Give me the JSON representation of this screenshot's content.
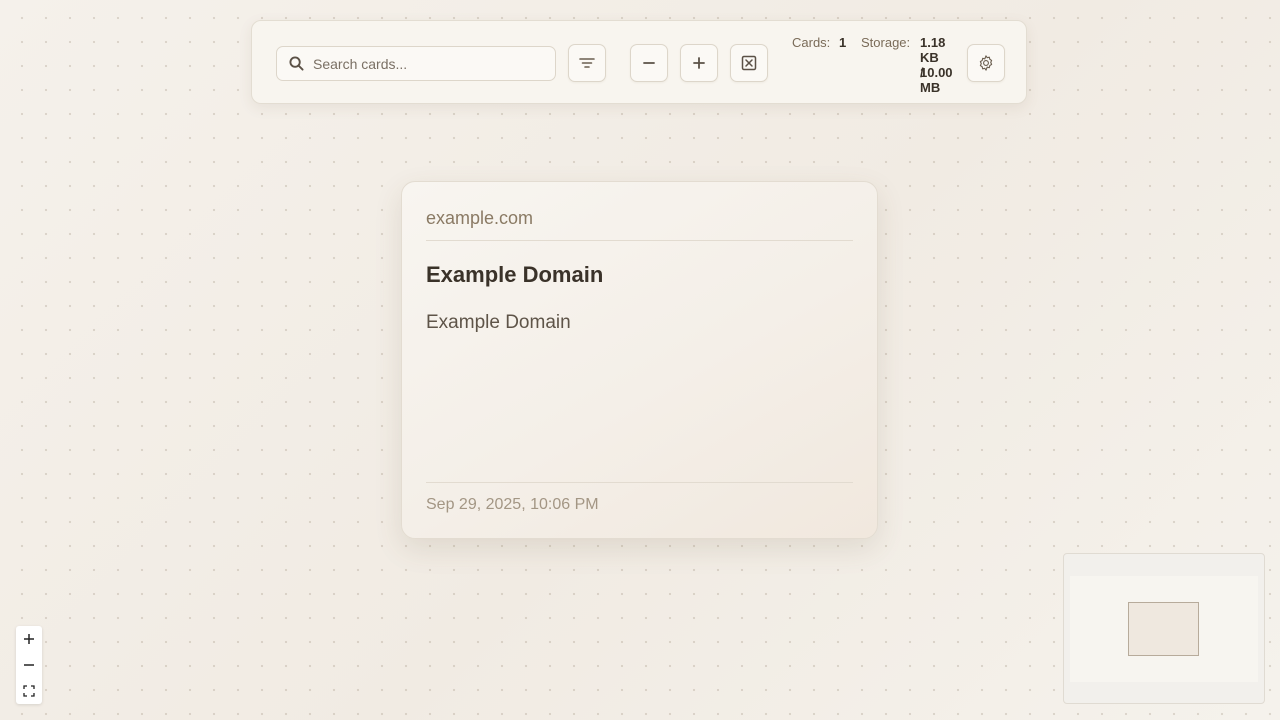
{
  "toolbar": {
    "search_placeholder": "Search cards...",
    "buttons": {
      "filter": "filter-icon",
      "zoom_out": "minus-icon",
      "zoom_in": "plus-icon",
      "fit": "close-box-icon",
      "settings": "gear-icon"
    },
    "stats": {
      "cards_label": "Cards:",
      "cards_value": "1",
      "storage_label": "Storage:",
      "storage_line1": "1.18",
      "storage_line2": "KB /",
      "storage_line3": "10.00",
      "storage_line4": "MB"
    }
  },
  "card": {
    "domain": "example.com",
    "title": "Example Domain",
    "excerpt": "Example Domain",
    "date": "Sep 29, 2025, 10:06 PM"
  },
  "canvas_controls": {
    "zoom_in": "plus-icon",
    "zoom_out": "minus-icon",
    "fit_view": "fullscreen-icon"
  },
  "minimap": {
    "node_count": 1
  },
  "colors": {
    "background": "#f3eee6",
    "text_primary": "#3a3229",
    "accent_brown": "#8a7a64"
  }
}
